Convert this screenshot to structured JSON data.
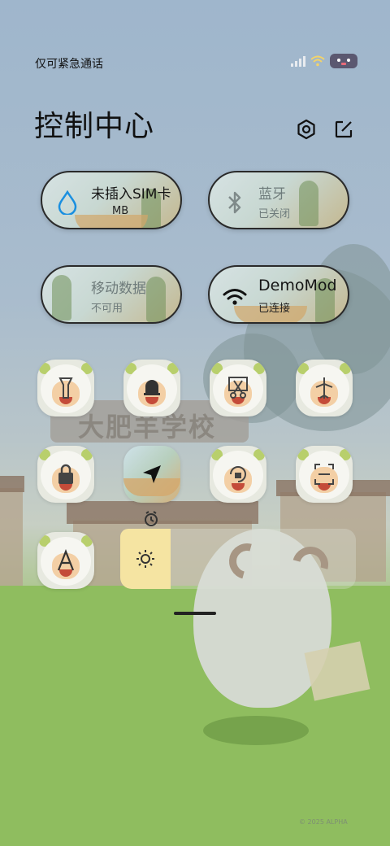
{
  "status_bar": {
    "carrier_text": "仅可紧急通话",
    "signal_level": 0,
    "battery_badge_icon": "sheep-face-icon"
  },
  "header": {
    "title": "控制中心",
    "settings_icon": "gear-icon",
    "edit_icon": "edit-icon"
  },
  "tiles": [
    {
      "label": "未插入SIM卡",
      "sub": "MB",
      "icon": "water-drop-icon",
      "active": true
    },
    {
      "label": "蓝牙",
      "sub": "已关闭",
      "icon": "bluetooth-icon",
      "active": false
    },
    {
      "label": "移动数据",
      "sub": "不可用",
      "icon": "mobile-data-icon",
      "active": false
    },
    {
      "label": "DemoMod",
      "sub": "已连接",
      "icon": "wifi-icon",
      "active": true
    }
  ],
  "toggles": [
    {
      "name": "flashlight",
      "icon": "flashlight-icon",
      "active": false
    },
    {
      "name": "ringer",
      "icon": "bell-icon",
      "active": false
    },
    {
      "name": "screenshot",
      "icon": "scissors-icon",
      "active": false
    },
    {
      "name": "airplane",
      "icon": "airplane-icon",
      "active": false
    },
    {
      "name": "lock",
      "icon": "lock-icon",
      "active": false
    },
    {
      "name": "location",
      "icon": "location-arrow-icon",
      "active": true
    },
    {
      "name": "rotation-lock",
      "icon": "rotation-lock-icon",
      "active": false
    },
    {
      "name": "scanner",
      "icon": "scan-icon",
      "active": false
    },
    {
      "name": "font-size",
      "icon": "font-icon",
      "active": false
    }
  ],
  "brightness": {
    "icon": "sun-icon",
    "level": 0.27
  },
  "background": {
    "sign_text": "大肥羊学校",
    "copyright": "© 2025 ALPHA"
  },
  "colors": {
    "tile_border": "#2a2a2a",
    "brightness_fill": "#f5e4a2",
    "text_primary": "#111111"
  }
}
